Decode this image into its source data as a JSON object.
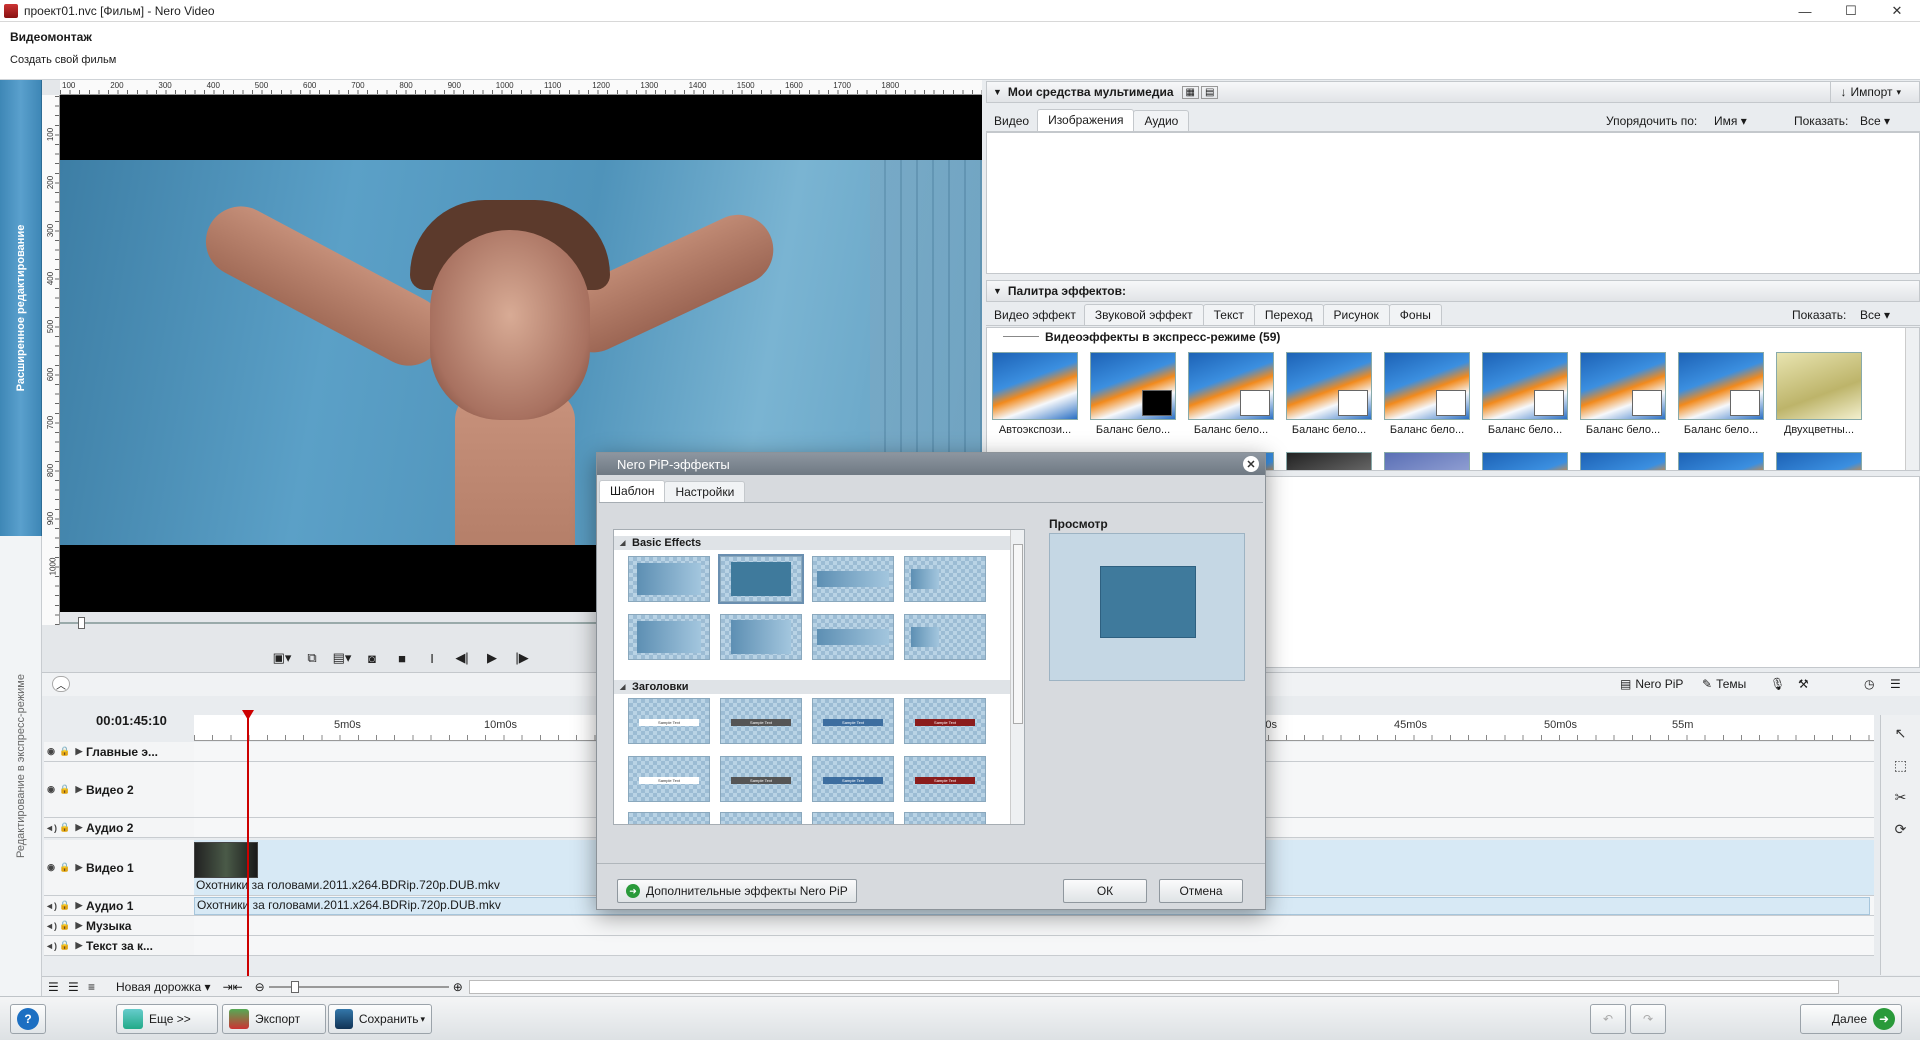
{
  "window": {
    "title": "проект01.nvc [Фильм] - Nero Video",
    "min": "—",
    "max": "☐",
    "close": "✕"
  },
  "header": {
    "title": "Видеомонтаж",
    "subtitle": "Создать свой фильм"
  },
  "side_tabs": {
    "advanced": "Расширенное редактирование",
    "express": "Редактирование в экспресс-режиме"
  },
  "ruler_h": [
    "100",
    "200",
    "300",
    "400",
    "500",
    "600",
    "700",
    "800",
    "900",
    "1000",
    "1100",
    "1200",
    "1300",
    "1400",
    "1500",
    "1600",
    "1700",
    "1800"
  ],
  "ruler_v": [
    "100",
    "200",
    "300",
    "400",
    "500",
    "600",
    "700",
    "800",
    "900",
    "1000"
  ],
  "media": {
    "header": "Мои средства мультимедиа",
    "import": "Импорт",
    "tabs": [
      "Видео",
      "Изображения",
      "Аудио"
    ],
    "sort_label": "Упорядочить по:",
    "sort_value": "Имя",
    "show_label": "Показать:",
    "show_value": "Все"
  },
  "effects": {
    "header": "Палитра эффектов:",
    "tabs": [
      "Видео эффект",
      "Звуковой эффект",
      "Текст",
      "Переход",
      "Рисунок",
      "Фоны"
    ],
    "show_label": "Показать:",
    "show_value": "Все",
    "group_title": "Видеоэффекты в экспресс-режиме (59)",
    "items": [
      "Автоэкспози...",
      "Баланс бело...",
      "Баланс бело...",
      "Баланс бело...",
      "Баланс бело...",
      "Баланс бело...",
      "Баланс бело...",
      "Баланс бело...",
      "Двухцветны..."
    ]
  },
  "timeline_toolbar": {
    "pip": "Nero PiP",
    "themes": "Темы"
  },
  "timeline": {
    "timecode": "00:01:45:10",
    "ticks": [
      "5m0s",
      "10m0s",
      "40m0s",
      "45m0s",
      "50m0s",
      "55m"
    ],
    "tracks": [
      "Главные э...",
      "Видео 2",
      "Аудио 2",
      "Видео 1",
      "Аудио 1",
      "Музыка",
      "Текст за к..."
    ],
    "clip_video": "Охотники за головами.2011.x264.BDRip.720p.DUB.mkv",
    "clip_audio": "Охотники за головами.2011.x264.BDRip.720p.DUB.mkv",
    "new_track": "Новая дорожка"
  },
  "footer": {
    "help": "?",
    "more": "Еще >>",
    "export": "Экспорт",
    "save": "Сохранить",
    "next": "Далее"
  },
  "dialog": {
    "title": "Nero PiP-эффекты",
    "tabs": [
      "Шаблон",
      "Настройки"
    ],
    "section_basic": "Basic Effects",
    "section_titles": "Заголовки",
    "sample_text": "Sample Text",
    "preview_label": "Просмотр",
    "more_button": "Дополнительные эффекты Nero PiP",
    "ok": "ОК",
    "cancel": "Отмена"
  }
}
